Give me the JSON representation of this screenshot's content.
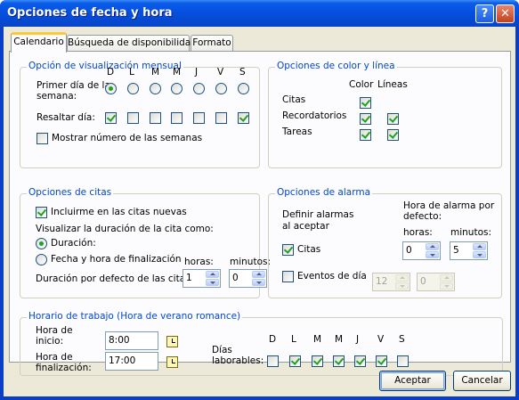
{
  "window": {
    "title": "Opciones de fecha y hora",
    "help_label": "?",
    "close_label": "✕"
  },
  "tabs": [
    {
      "label": "Calendario",
      "active": true
    },
    {
      "label": "Búsqueda de disponibilidad",
      "active": false
    },
    {
      "label": "Formato",
      "active": false
    }
  ],
  "monthly": {
    "title": "Opción de visualización mensual",
    "days": [
      "D",
      "L",
      "M",
      "M",
      "J",
      "V",
      "S"
    ],
    "first_day_label_1": "Primer día de la",
    "first_day_label_2": "semana:",
    "first_day_selected_index": 0,
    "highlight_label": "Resaltar día:",
    "highlight_checked": [
      true,
      false,
      false,
      false,
      false,
      false,
      true
    ],
    "show_week_numbers_label": "Mostrar número de las semanas",
    "show_week_numbers": false
  },
  "colors": {
    "title": "Opciones de color y línea",
    "col_color": "Color",
    "col_lines": "Líneas",
    "rows": [
      {
        "label": "Citas",
        "color": true,
        "lines": null
      },
      {
        "label": "Recordatorios",
        "color": true,
        "lines": true
      },
      {
        "label": "Tareas",
        "color": true,
        "lines": true
      }
    ]
  },
  "appointments": {
    "title": "Opciones de citas",
    "include_new_label": "Incluirme en las citas nuevas",
    "include_new": true,
    "visualize_label": "Visualizar la duración de la cita como:",
    "duration_label": "Duración:",
    "end_label": "Fecha y hora de finalización",
    "duration_selected": true,
    "default_duration_label": "Duración por defecto de las citas:",
    "hours_label": "horas:",
    "minutes_label": "minutos:",
    "hours_value": "1",
    "minutes_value": "0"
  },
  "alarm": {
    "title": "Opciones de alarma",
    "define_label_1": "Definir alarmas",
    "define_label_2": "al aceptar",
    "default_label_1": "Hora de alarma por",
    "default_label_2": "defecto:",
    "hours_label": "horas:",
    "minutes_label": "minutos:",
    "citas_label": "Citas",
    "citas_checked": true,
    "citas_hours": "0",
    "citas_minutes": "5",
    "events_label": "Eventos de día",
    "events_checked": false,
    "events_hours": "12",
    "events_minutes": "0"
  },
  "work": {
    "title": "Horario de trabajo (Hora de verano romance)",
    "start_label_1": "Hora de",
    "start_label_2": "inicio:",
    "start_value": "8:00",
    "end_label_1": "Hora de",
    "end_label_2": "finalización:",
    "end_value": "17:00",
    "days_label_1": "Días",
    "days_label_2": "laborables:",
    "days": [
      "D",
      "L",
      "M",
      "M",
      "J",
      "V",
      "S"
    ],
    "days_checked": [
      false,
      true,
      true,
      true,
      true,
      true,
      false
    ]
  },
  "footer": {
    "ok_label": "Aceptar",
    "cancel_label": "Cancelar"
  },
  "colors_theme": {
    "title_bar": "#0650e0",
    "group_title": "#0046d5",
    "check": "#21a121",
    "tab_highlight": "#ffc83c"
  }
}
